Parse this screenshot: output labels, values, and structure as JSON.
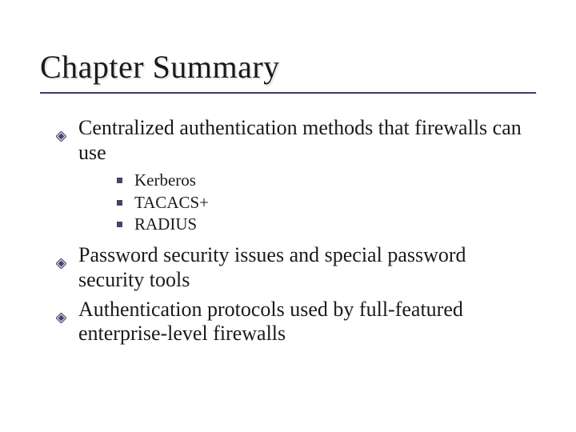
{
  "title": "Chapter Summary",
  "colors": {
    "accent": "#4a3f6b"
  },
  "bullets": [
    {
      "text": "Centralized authentication methods that firewalls can use",
      "children": [
        {
          "text": "Kerberos"
        },
        {
          "text": "TACACS+"
        },
        {
          "text": "RADIUS"
        }
      ]
    },
    {
      "text": "Password security issues and special password security tools",
      "children": []
    },
    {
      "text": "Authentication protocols used by full-featured enterprise-level firewalls",
      "children": []
    }
  ]
}
